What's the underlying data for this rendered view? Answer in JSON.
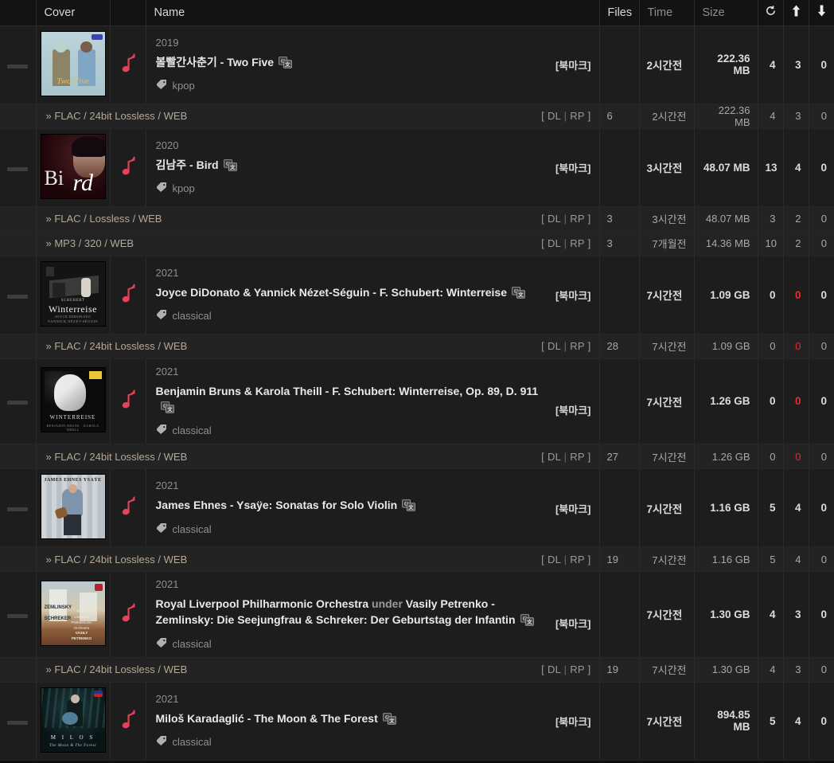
{
  "header": {
    "columns": [
      {
        "key": "select",
        "label": ""
      },
      {
        "key": "cover",
        "label": "Cover"
      },
      {
        "key": "note",
        "label": ""
      },
      {
        "key": "name",
        "label": "Name"
      },
      {
        "key": "files",
        "label": "Files"
      },
      {
        "key": "time",
        "label": "Time"
      },
      {
        "key": "size",
        "label": "Size"
      },
      {
        "key": "refresh",
        "label": "↻",
        "icon": "refresh-icon"
      },
      {
        "key": "seeders",
        "label": "↑",
        "icon": "arrow-up-icon"
      },
      {
        "key": "leechers",
        "label": "↓",
        "icon": "arrow-down-icon"
      }
    ]
  },
  "labels": {
    "bookmark": "[북마크]",
    "dl": "DL",
    "rp": "RP",
    "bracket_open": "[",
    "bracket_close": "]",
    "pipe": "|",
    "chevron": "»"
  },
  "colors": {
    "accent_red": "#e03030",
    "note_icon": "#e8405a",
    "row_bg": "#1d1d1d",
    "subrow_bg": "#232323",
    "header_bg": "#131313",
    "title_text": "#e9e9e9",
    "muted_text": "#8e8e8e",
    "format_text": "#b5a894"
  },
  "torrents": [
    {
      "year": "2019",
      "title": "볼빨간사춘기 - Two Five",
      "title_soft": "",
      "tag": "kpop",
      "bookmark": "[북마크]",
      "time": "2시간전",
      "size": "222.36 MB",
      "files": "4",
      "seeders": "3",
      "leechers": "0",
      "seeders_zero": false,
      "cover": {
        "id": "two-five",
        "style": "bolbbalgan"
      },
      "files_list": [
        {
          "format": "FLAC / 24bit Lossless / WEB",
          "count": "6",
          "time": "2시간전",
          "size": "222.36 MB",
          "files": "4",
          "seeders": "3",
          "leechers": "0",
          "seeders_zero": false
        }
      ]
    },
    {
      "year": "2020",
      "title": "김남주 - Bird",
      "title_soft": "",
      "tag": "kpop",
      "bookmark": "[북마크]",
      "time": "3시간전",
      "size": "48.07 MB",
      "files": "13",
      "seeders": "4",
      "leechers": "0",
      "seeders_zero": false,
      "cover": {
        "id": "bird",
        "style": "bird"
      },
      "files_list": [
        {
          "format": "FLAC / Lossless / WEB",
          "count": "3",
          "time": "3시간전",
          "size": "48.07 MB",
          "files": "3",
          "seeders": "2",
          "leechers": "0",
          "seeders_zero": false
        },
        {
          "format": "MP3 / 320 / WEB",
          "count": "3",
          "time": "7개월전",
          "size": "14.36 MB",
          "files": "10",
          "seeders": "2",
          "leechers": "0",
          "seeders_zero": false
        }
      ]
    },
    {
      "year": "2021",
      "title": "Joyce DiDonato & Yannick Nézet-Séguin - F. Schubert: Winterreise",
      "title_soft": "",
      "tag": "classical",
      "bookmark": "[북마크]",
      "time": "7시간전",
      "size": "1.09 GB",
      "files": "0",
      "seeders": "0",
      "leechers": "0",
      "seeders_zero": true,
      "cover": {
        "id": "winterreise-didonato",
        "style": "didonato"
      },
      "files_list": [
        {
          "format": "FLAC / 24bit Lossless / WEB",
          "count": "28",
          "time": "7시간전",
          "size": "1.09 GB",
          "files": "0",
          "seeders": "0",
          "leechers": "0",
          "seeders_zero": true
        }
      ]
    },
    {
      "year": "2021",
      "title": "Benjamin Bruns & Karola Theill - F. Schubert: Winterreise, Op. 89, D. 911",
      "title_soft": "",
      "tag": "classical",
      "bookmark": "[북마크]",
      "time": "7시간전",
      "size": "1.26 GB",
      "files": "0",
      "seeders": "0",
      "leechers": "0",
      "seeders_zero": true,
      "cover": {
        "id": "winterreise-bruns",
        "style": "bruns"
      },
      "files_list": [
        {
          "format": "FLAC / 24bit Lossless / WEB",
          "count": "27",
          "time": "7시간전",
          "size": "1.26 GB",
          "files": "0",
          "seeders": "0",
          "leechers": "0",
          "seeders_zero": true
        }
      ]
    },
    {
      "year": "2021",
      "title": "James Ehnes - Ysaÿe: Sonatas for Solo Violin",
      "title_soft": "",
      "tag": "classical",
      "bookmark": "[북마크]",
      "time": "7시간전",
      "size": "1.16 GB",
      "files": "5",
      "seeders": "4",
      "leechers": "0",
      "seeders_zero": false,
      "cover": {
        "id": "ehnes-ysaye",
        "style": "ehnes"
      },
      "files_list": [
        {
          "format": "FLAC / 24bit Lossless / WEB",
          "count": "19",
          "time": "7시간전",
          "size": "1.16 GB",
          "files": "5",
          "seeders": "4",
          "leechers": "0",
          "seeders_zero": false
        }
      ]
    },
    {
      "year": "2021",
      "title": "Royal Liverpool Philharmonic Orchestra under Vasily Petrenko - Zemlinsky: Die Seejungfrau & Schreker: Der Geburtstag der Infantin",
      "title_soft": "under",
      "tag": "classical",
      "bookmark": "[북마크]",
      "time": "7시간전",
      "size": "1.30 GB",
      "files": "4",
      "seeders": "3",
      "leechers": "0",
      "seeders_zero": false,
      "cover": {
        "id": "zemlinsky",
        "style": "zemlinsky"
      },
      "files_list": [
        {
          "format": "FLAC / 24bit Lossless / WEB",
          "count": "19",
          "time": "7시간전",
          "size": "1.30 GB",
          "files": "4",
          "seeders": "3",
          "leechers": "0",
          "seeders_zero": false
        }
      ]
    },
    {
      "year": "2021",
      "title": "Miloš Karadaglić - The Moon & The Forest",
      "title_soft": "",
      "tag": "classical",
      "bookmark": "[북마크]",
      "time": "7시간전",
      "size": "894.85 MB",
      "files": "5",
      "seeders": "4",
      "leechers": "0",
      "seeders_zero": false,
      "cover": {
        "id": "moon-forest",
        "style": "milos"
      },
      "files_list": []
    }
  ]
}
